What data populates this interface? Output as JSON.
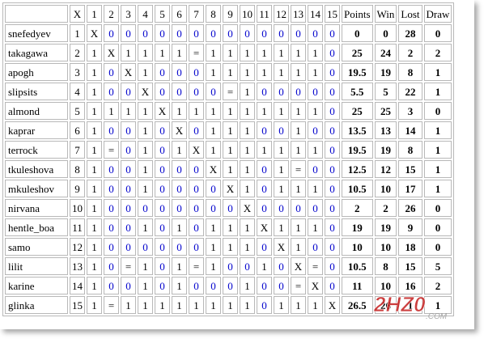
{
  "header": {
    "corner": "",
    "x_label": "X",
    "columns": [
      "1",
      "2",
      "3",
      "4",
      "5",
      "6",
      "7",
      "8",
      "9",
      "10",
      "11",
      "12",
      "13",
      "14",
      "15"
    ],
    "totals": [
      "Points",
      "Win",
      "Lost",
      "Draw"
    ]
  },
  "rows": [
    {
      "name": "snefedyev",
      "num": "1",
      "cells": [
        "X",
        "0",
        "0",
        "0",
        "0",
        "0",
        "0",
        "0",
        "0",
        "0",
        "0",
        "0",
        "0",
        "0",
        "0"
      ],
      "points": "0",
      "win": "0",
      "lost": "28",
      "draw": "0"
    },
    {
      "name": "takagawa",
      "num": "2",
      "cells": [
        "1",
        "X",
        "1",
        "1",
        "1",
        "1",
        "=",
        "1",
        "1",
        "1",
        "1",
        "1",
        "1",
        "1",
        "0"
      ],
      "points": "25",
      "win": "24",
      "lost": "2",
      "draw": "2"
    },
    {
      "name": "apogh",
      "num": "3",
      "cells": [
        "1",
        "0",
        "X",
        "1",
        "0",
        "0",
        "0",
        "1",
        "1",
        "1",
        "1",
        "1",
        "1",
        "1",
        "0"
      ],
      "points": "19.5",
      "win": "19",
      "lost": "8",
      "draw": "1"
    },
    {
      "name": "slipsits",
      "num": "4",
      "cells": [
        "1",
        "0",
        "0",
        "X",
        "0",
        "0",
        "0",
        "0",
        "=",
        "1",
        "0",
        "0",
        "0",
        "0",
        "0"
      ],
      "points": "5.5",
      "win": "5",
      "lost": "22",
      "draw": "1"
    },
    {
      "name": "almond",
      "num": "5",
      "cells": [
        "1",
        "1",
        "1",
        "1",
        "X",
        "1",
        "1",
        "1",
        "1",
        "1",
        "1",
        "1",
        "1",
        "1",
        "0"
      ],
      "points": "25",
      "win": "25",
      "lost": "3",
      "draw": "0"
    },
    {
      "name": "kaprar",
      "num": "6",
      "cells": [
        "1",
        "0",
        "0",
        "1",
        "0",
        "X",
        "0",
        "1",
        "1",
        "1",
        "0",
        "0",
        "1",
        "0",
        "0"
      ],
      "points": "13.5",
      "win": "13",
      "lost": "14",
      "draw": "1"
    },
    {
      "name": "terrock",
      "num": "7",
      "cells": [
        "1",
        "=",
        "0",
        "1",
        "0",
        "1",
        "X",
        "1",
        "1",
        "1",
        "1",
        "1",
        "1",
        "1",
        "0"
      ],
      "points": "19.5",
      "win": "19",
      "lost": "8",
      "draw": "1"
    },
    {
      "name": "tkuleshova",
      "num": "8",
      "cells": [
        "1",
        "0",
        "0",
        "1",
        "0",
        "0",
        "0",
        "X",
        "1",
        "1",
        "0",
        "1",
        "=",
        "0",
        "0"
      ],
      "points": "12.5",
      "win": "12",
      "lost": "15",
      "draw": "1"
    },
    {
      "name": "mkuleshov",
      "num": "9",
      "cells": [
        "1",
        "0",
        "0",
        "1",
        "0",
        "0",
        "0",
        "0",
        "X",
        "1",
        "0",
        "1",
        "1",
        "1",
        "0"
      ],
      "points": "10.5",
      "win": "10",
      "lost": "17",
      "draw": "1"
    },
    {
      "name": "nirvana",
      "num": "10",
      "cells": [
        "1",
        "0",
        "0",
        "0",
        "0",
        "0",
        "0",
        "0",
        "0",
        "X",
        "0",
        "0",
        "0",
        "0",
        "0"
      ],
      "points": "2",
      "win": "2",
      "lost": "26",
      "draw": "0"
    },
    {
      "name": "hentle_boa",
      "num": "11",
      "cells": [
        "1",
        "0",
        "0",
        "1",
        "0",
        "1",
        "0",
        "1",
        "1",
        "1",
        "X",
        "1",
        "1",
        "1",
        "0"
      ],
      "points": "19",
      "win": "19",
      "lost": "9",
      "draw": "0"
    },
    {
      "name": "samo",
      "num": "12",
      "cells": [
        "1",
        "0",
        "0",
        "0",
        "0",
        "0",
        "0",
        "1",
        "1",
        "1",
        "0",
        "X",
        "1",
        "0",
        "0"
      ],
      "points": "10",
      "win": "10",
      "lost": "18",
      "draw": "0"
    },
    {
      "name": "lilit",
      "num": "13",
      "cells": [
        "1",
        "0",
        "=",
        "1",
        "0",
        "1",
        "=",
        "1",
        "0",
        "0",
        "1",
        "0",
        "X",
        "=",
        "0"
      ],
      "points": "10.5",
      "win": "8",
      "lost": "15",
      "draw": "5"
    },
    {
      "name": "karine",
      "num": "14",
      "cells": [
        "1",
        "0",
        "0",
        "1",
        "0",
        "1",
        "0",
        "0",
        "0",
        "1",
        "0",
        "0",
        "=",
        "X",
        "0"
      ],
      "points": "11",
      "win": "10",
      "lost": "16",
      "draw": "2"
    },
    {
      "name": "glinka",
      "num": "15",
      "cells": [
        "1",
        "=",
        "1",
        "1",
        "1",
        "1",
        "1",
        "1",
        "1",
        "1",
        "0",
        "1",
        "1",
        "1",
        "X"
      ],
      "points": "26.5",
      "win": "26",
      "lost": "1",
      "draw": "1"
    }
  ],
  "watermark": {
    "text": "2HZ0",
    "subtext": ".COM",
    "color": "#c41e1e"
  }
}
